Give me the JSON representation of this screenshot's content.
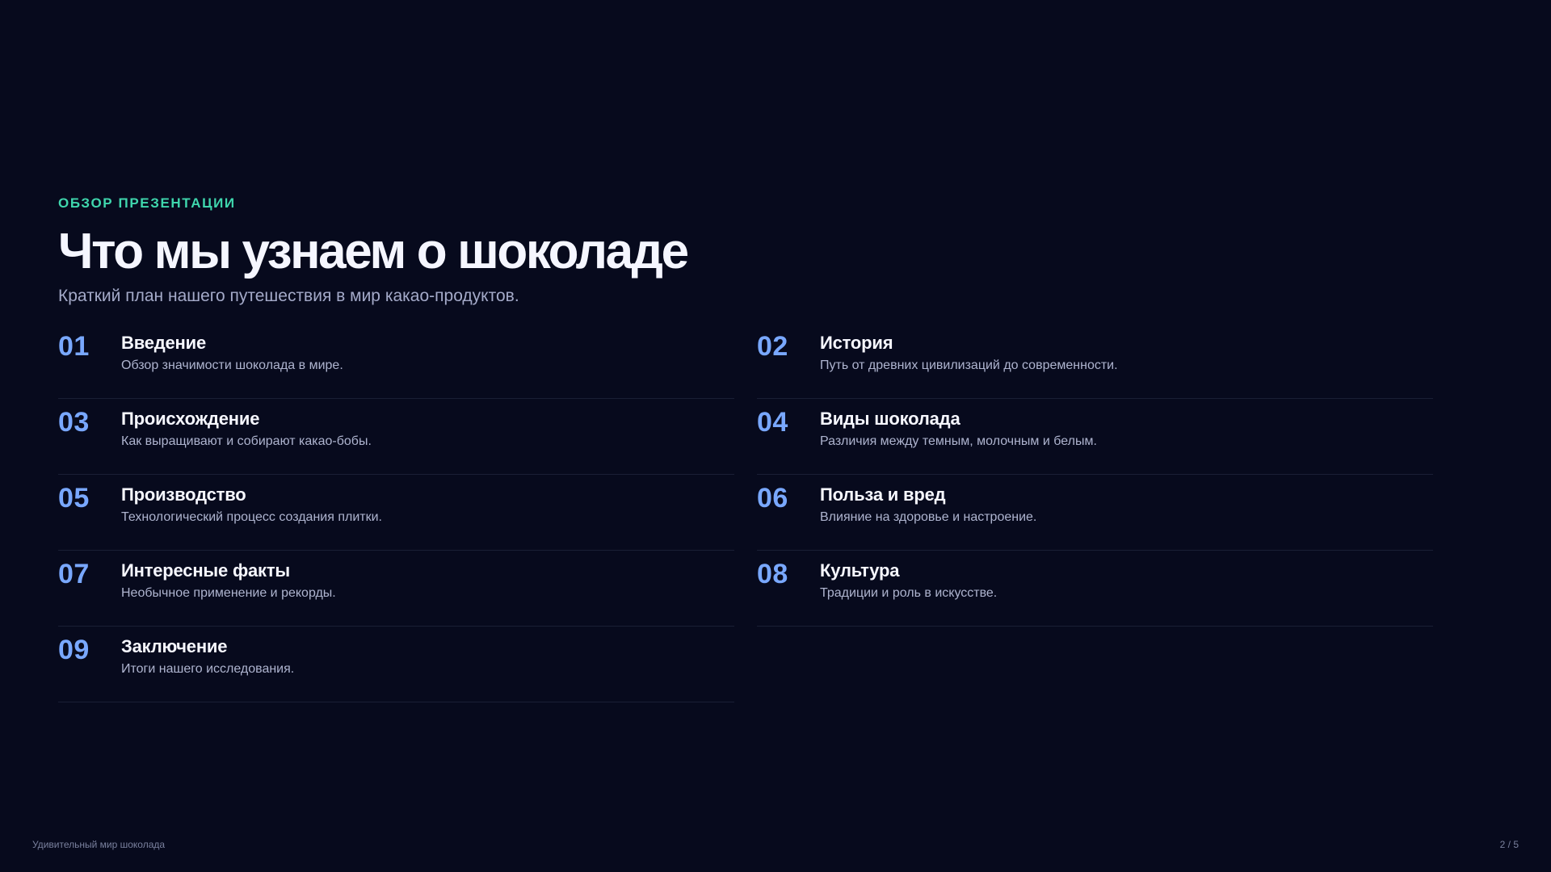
{
  "presentation": {
    "eyebrow": "ОБЗОР ПРЕЗЕНТАЦИИ",
    "title": "Что мы узнаем о шоколаде",
    "subtitle": "Краткий план нашего путешествия в мир какао-продуктов.",
    "footer": "Удивительный мир шоколада",
    "page_indicator": "2 / 5"
  },
  "colors": {
    "background": "#070a1d",
    "accent_teal": "#3fd6ad",
    "accent_blue": "#79a8ff",
    "text_primary": "#f5f6ff",
    "text_secondary": "#a4aac9"
  },
  "sections": [
    {
      "number": "01",
      "title": "Введение",
      "description": "Обзор значимости шоколада в мире."
    },
    {
      "number": "02",
      "title": "История",
      "description": "Путь от древних цивилизаций до современности."
    },
    {
      "number": "03",
      "title": "Происхождение",
      "description": "Как выращивают и собирают какао-бобы."
    },
    {
      "number": "04",
      "title": "Виды шоколада",
      "description": "Различия между темным, молочным и белым."
    },
    {
      "number": "05",
      "title": "Производство",
      "description": "Технологический процесс создания плитки."
    },
    {
      "number": "06",
      "title": "Польза и вред",
      "description": "Влияние на здоровье и настроение."
    },
    {
      "number": "07",
      "title": "Интересные факты",
      "description": "Необычное применение и рекорды."
    },
    {
      "number": "08",
      "title": "Культура",
      "description": "Традиции и роль в искусстве."
    },
    {
      "number": "09",
      "title": "Заключение",
      "description": "Итоги нашего исследования."
    }
  ]
}
